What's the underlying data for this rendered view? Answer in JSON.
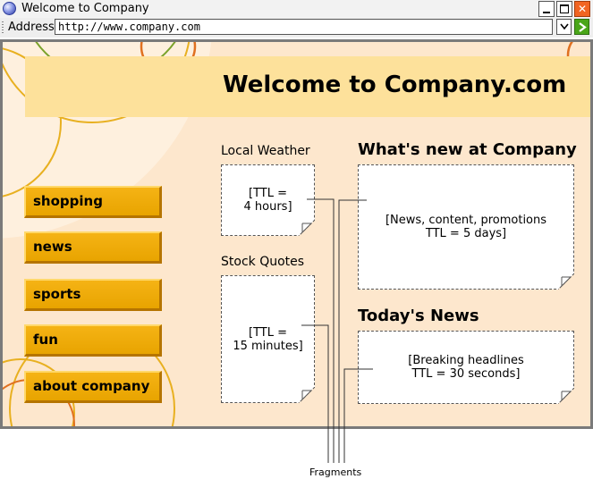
{
  "window": {
    "title": "Welcome to Company",
    "controls": {
      "minimize": "",
      "maximize": "",
      "close": "✕"
    }
  },
  "address_bar": {
    "label": "Address",
    "url": "http://www.company.com"
  },
  "page": {
    "heading": "Welcome to Company.com",
    "colors": {
      "background": "#fde7cd",
      "header_band": "#fde19b",
      "nav_button": "#f0aa00"
    },
    "nav": [
      {
        "label": "shopping"
      },
      {
        "label": "news"
      },
      {
        "label": "sports"
      },
      {
        "label": "fun"
      },
      {
        "label": "about company"
      }
    ],
    "sections": {
      "weather": {
        "label": "Local Weather",
        "content": "[TTL =\n4 hours]"
      },
      "stocks": {
        "label": "Stock Quotes",
        "content": "[TTL =\n15 minutes]"
      },
      "whats_new": {
        "title": "What's new at Company",
        "content": "[News, content, promotions\nTTL = 5 days]"
      },
      "todays_news": {
        "title": "Today's News",
        "content": "[Breaking headlines\nTTL = 30 seconds]"
      }
    }
  },
  "annotation": {
    "caption": "Fragments"
  }
}
